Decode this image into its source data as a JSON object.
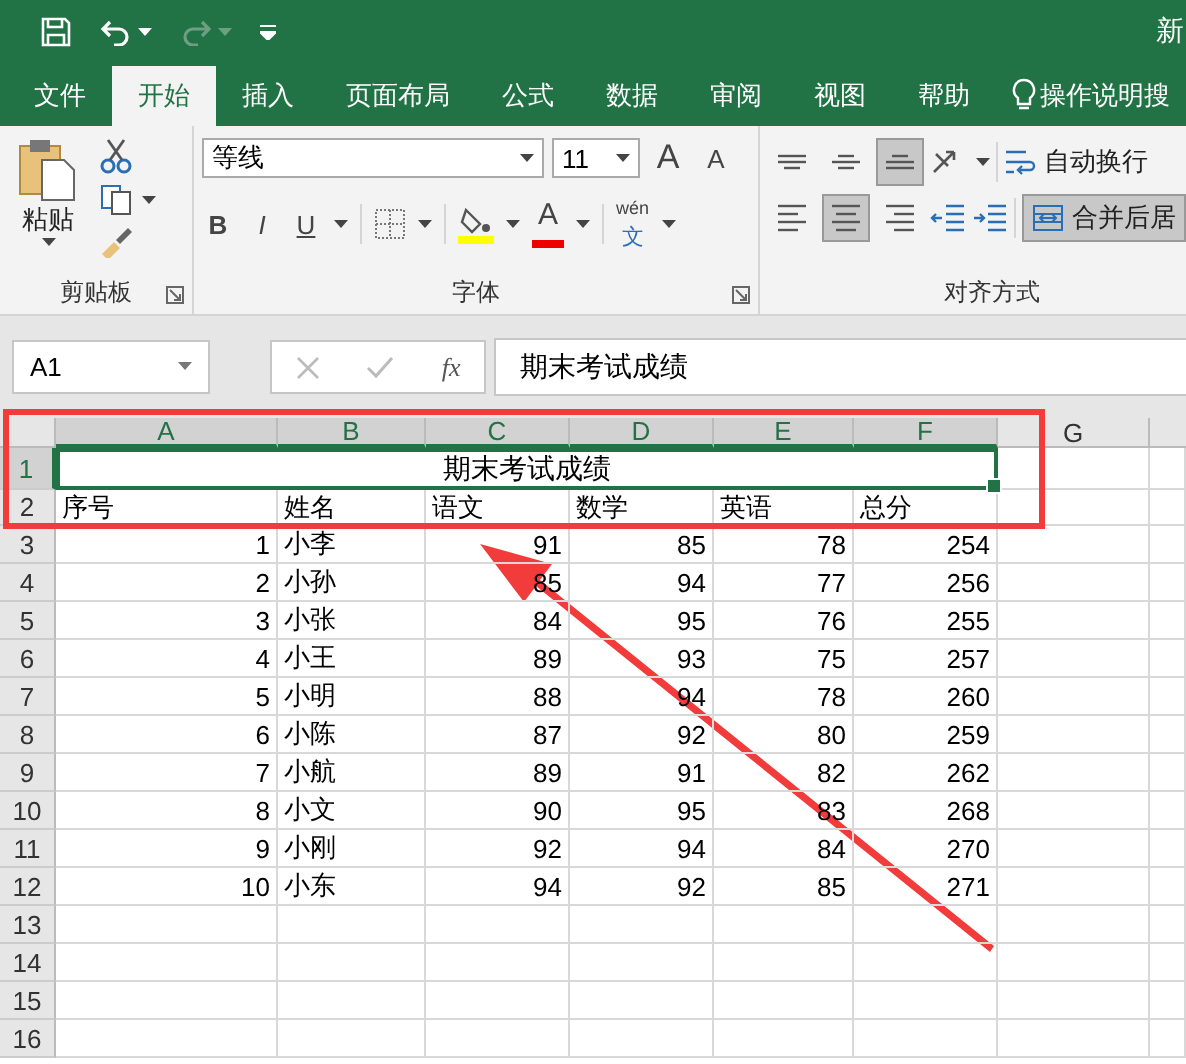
{
  "title_bar": {
    "title": "新"
  },
  "tabs": [
    {
      "label": "文件",
      "selected": false
    },
    {
      "label": "开始",
      "selected": true
    },
    {
      "label": "插入",
      "selected": false
    },
    {
      "label": "页面布局",
      "selected": false
    },
    {
      "label": "公式",
      "selected": false
    },
    {
      "label": "数据",
      "selected": false
    },
    {
      "label": "审阅",
      "selected": false
    },
    {
      "label": "视图",
      "selected": false
    },
    {
      "label": "帮助",
      "selected": false
    }
  ],
  "tell_me": "操作说明搜",
  "ribbon": {
    "clipboard": {
      "paste": "粘贴",
      "group": "剪贴板"
    },
    "font": {
      "name": "等线",
      "size": "11",
      "grow": "A",
      "shrink": "A",
      "bold": "B",
      "italic": "I",
      "underline": "U",
      "font_color": "A",
      "phonetic_top": "wén",
      "phonetic_bottom": "文",
      "group": "字体"
    },
    "alignment": {
      "vertical": [
        {
          "kind": "top",
          "selected": false
        },
        {
          "kind": "middle",
          "selected": false
        },
        {
          "kind": "bottom",
          "selected": true
        }
      ],
      "horizontal": [
        {
          "kind": "left",
          "selected": false
        },
        {
          "kind": "center",
          "selected": true
        },
        {
          "kind": "right",
          "selected": false
        }
      ],
      "wrap_text": "自动换行",
      "merge_center": {
        "label": "合并后居",
        "selected": true
      },
      "group": "对齐方式"
    }
  },
  "formula_bar": {
    "name_box": "A1",
    "function_label": "fx",
    "content": "期末考试成绩"
  },
  "sheet": {
    "columns": [
      {
        "label": "A",
        "selected": true
      },
      {
        "label": "B",
        "selected": true
      },
      {
        "label": "C",
        "selected": true
      },
      {
        "label": "D",
        "selected": true
      },
      {
        "label": "E",
        "selected": true
      },
      {
        "label": "F",
        "selected": true
      },
      {
        "label": "G",
        "selected": false
      }
    ],
    "row_numbers": [
      {
        "label": "1",
        "selected": true
      },
      {
        "label": "2",
        "selected": false
      },
      {
        "label": "3",
        "selected": false
      },
      {
        "label": "4",
        "selected": false
      },
      {
        "label": "5",
        "selected": false
      },
      {
        "label": "6",
        "selected": false
      },
      {
        "label": "7",
        "selected": false
      },
      {
        "label": "8",
        "selected": false
      },
      {
        "label": "9",
        "selected": false
      },
      {
        "label": "10",
        "selected": false
      },
      {
        "label": "11",
        "selected": false
      },
      {
        "label": "12",
        "selected": false
      },
      {
        "label": "13",
        "selected": false
      },
      {
        "label": "14",
        "selected": false
      },
      {
        "label": "15",
        "selected": false
      },
      {
        "label": "16",
        "selected": false
      }
    ],
    "title": {
      "text": "期末考试成绩",
      "selected": true
    },
    "headers": [
      "序号",
      "姓名",
      "语文",
      "数学",
      "英语",
      "总分"
    ],
    "rows": [
      [
        "1",
        "小李",
        "91",
        "85",
        "78",
        "254"
      ],
      [
        "2",
        "小孙",
        "85",
        "94",
        "77",
        "256"
      ],
      [
        "3",
        "小张",
        "84",
        "95",
        "76",
        "255"
      ],
      [
        "4",
        "小王",
        "89",
        "93",
        "75",
        "257"
      ],
      [
        "5",
        "小明",
        "88",
        "94",
        "78",
        "260"
      ],
      [
        "6",
        "小陈",
        "87",
        "92",
        "80",
        "259"
      ],
      [
        "7",
        "小航",
        "89",
        "91",
        "82",
        "262"
      ],
      [
        "8",
        "小文",
        "90",
        "95",
        "83",
        "268"
      ],
      [
        "9",
        "小刚",
        "92",
        "94",
        "84",
        "270"
      ],
      [
        "10",
        "小东",
        "94",
        "92",
        "85",
        "271"
      ]
    ]
  },
  "annotations": {
    "box": true,
    "arrow": true
  }
}
